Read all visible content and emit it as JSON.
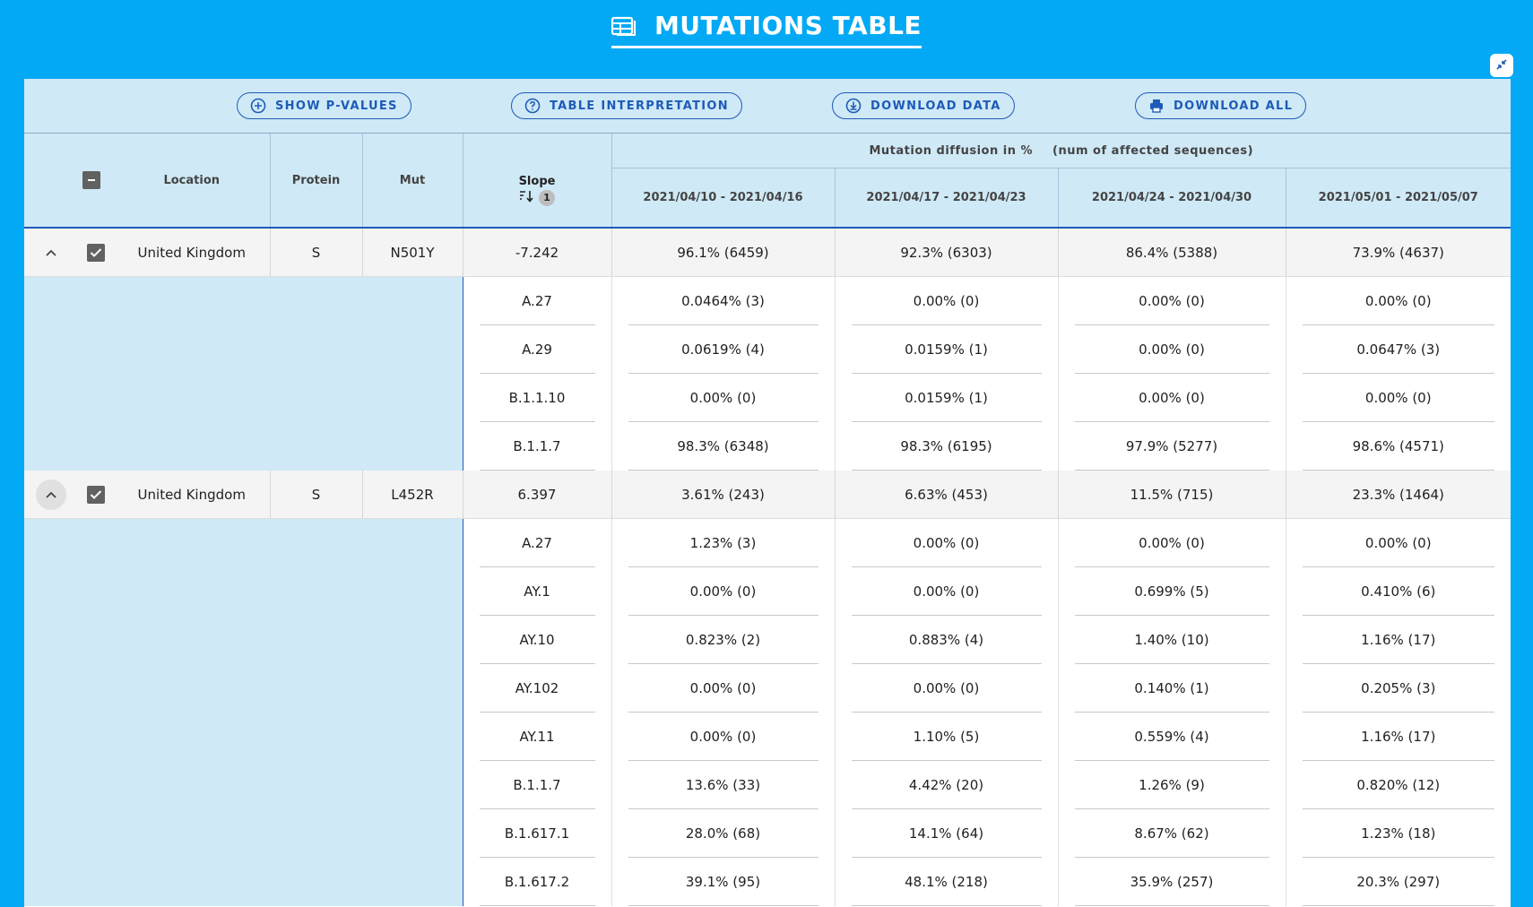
{
  "header": {
    "title": "MUTATIONS TABLE",
    "title_icon": "table-icon",
    "collapse_icon": "collapse-icon"
  },
  "toolbar": {
    "show_pvalues": "SHOW P-VALUES",
    "table_interpretation": "TABLE INTERPRETATION",
    "download_data": "DOWNLOAD DATA",
    "download_all": "DOWNLOAD ALL"
  },
  "table": {
    "columns": {
      "location": "Location",
      "protein": "Protein",
      "mut": "Mut",
      "slope": "Slope",
      "slope_sort_order": "1",
      "group_label": "Mutation diffusion in %",
      "group_sublabel": "(num of affected sequences)",
      "periods": [
        "2021/04/10 - 2021/04/16",
        "2021/04/17 - 2021/04/23",
        "2021/04/24 - 2021/04/30",
        "2021/05/01 - 2021/05/07"
      ]
    },
    "rows": [
      {
        "location": "United Kingdom",
        "protein": "S",
        "mut": "N501Y",
        "slope": "-7.242",
        "values": [
          "96.1% (6459)",
          "92.3% (6303)",
          "86.4% (5388)",
          "73.9% (4637)"
        ],
        "expanded": true,
        "checked": true,
        "lineages": [
          {
            "name": "A.27",
            "values": [
              "0.0464% (3)",
              "0.00% (0)",
              "0.00% (0)",
              "0.00% (0)"
            ]
          },
          {
            "name": "A.29",
            "values": [
              "0.0619% (4)",
              "0.0159% (1)",
              "0.00% (0)",
              "0.0647% (3)"
            ]
          },
          {
            "name": "B.1.1.10",
            "values": [
              "0.00% (0)",
              "0.0159% (1)",
              "0.00% (0)",
              "0.00% (0)"
            ]
          },
          {
            "name": "B.1.1.7",
            "values": [
              "98.3% (6348)",
              "98.3% (6195)",
              "97.9% (5277)",
              "98.6% (4571)"
            ]
          }
        ]
      },
      {
        "location": "United Kingdom",
        "protein": "S",
        "mut": "L452R",
        "slope": "6.397",
        "values": [
          "3.61% (243)",
          "6.63% (453)",
          "11.5% (715)",
          "23.3% (1464)"
        ],
        "expanded": true,
        "checked": true,
        "lineages": [
          {
            "name": "A.27",
            "values": [
              "1.23% (3)",
              "0.00% (0)",
              "0.00% (0)",
              "0.00% (0)"
            ]
          },
          {
            "name": "AY.1",
            "values": [
              "0.00% (0)",
              "0.00% (0)",
              "0.699% (5)",
              "0.410% (6)"
            ]
          },
          {
            "name": "AY.10",
            "values": [
              "0.823% (2)",
              "0.883% (4)",
              "1.40% (10)",
              "1.16% (17)"
            ]
          },
          {
            "name": "AY.102",
            "values": [
              "0.00% (0)",
              "0.00% (0)",
              "0.140% (1)",
              "0.205% (3)"
            ]
          },
          {
            "name": "AY.11",
            "values": [
              "0.00% (0)",
              "1.10% (5)",
              "0.559% (4)",
              "1.16% (17)"
            ]
          },
          {
            "name": "B.1.1.7",
            "values": [
              "13.6% (33)",
              "4.42% (20)",
              "1.26% (9)",
              "0.820% (12)"
            ]
          },
          {
            "name": "B.1.617.1",
            "values": [
              "28.0% (68)",
              "14.1% (64)",
              "8.67% (62)",
              "1.23% (18)"
            ]
          },
          {
            "name": "B.1.617.2",
            "values": [
              "39.1% (95)",
              "48.1% (218)",
              "35.9% (257)",
              "20.3% (297)"
            ]
          }
        ]
      }
    ]
  }
}
